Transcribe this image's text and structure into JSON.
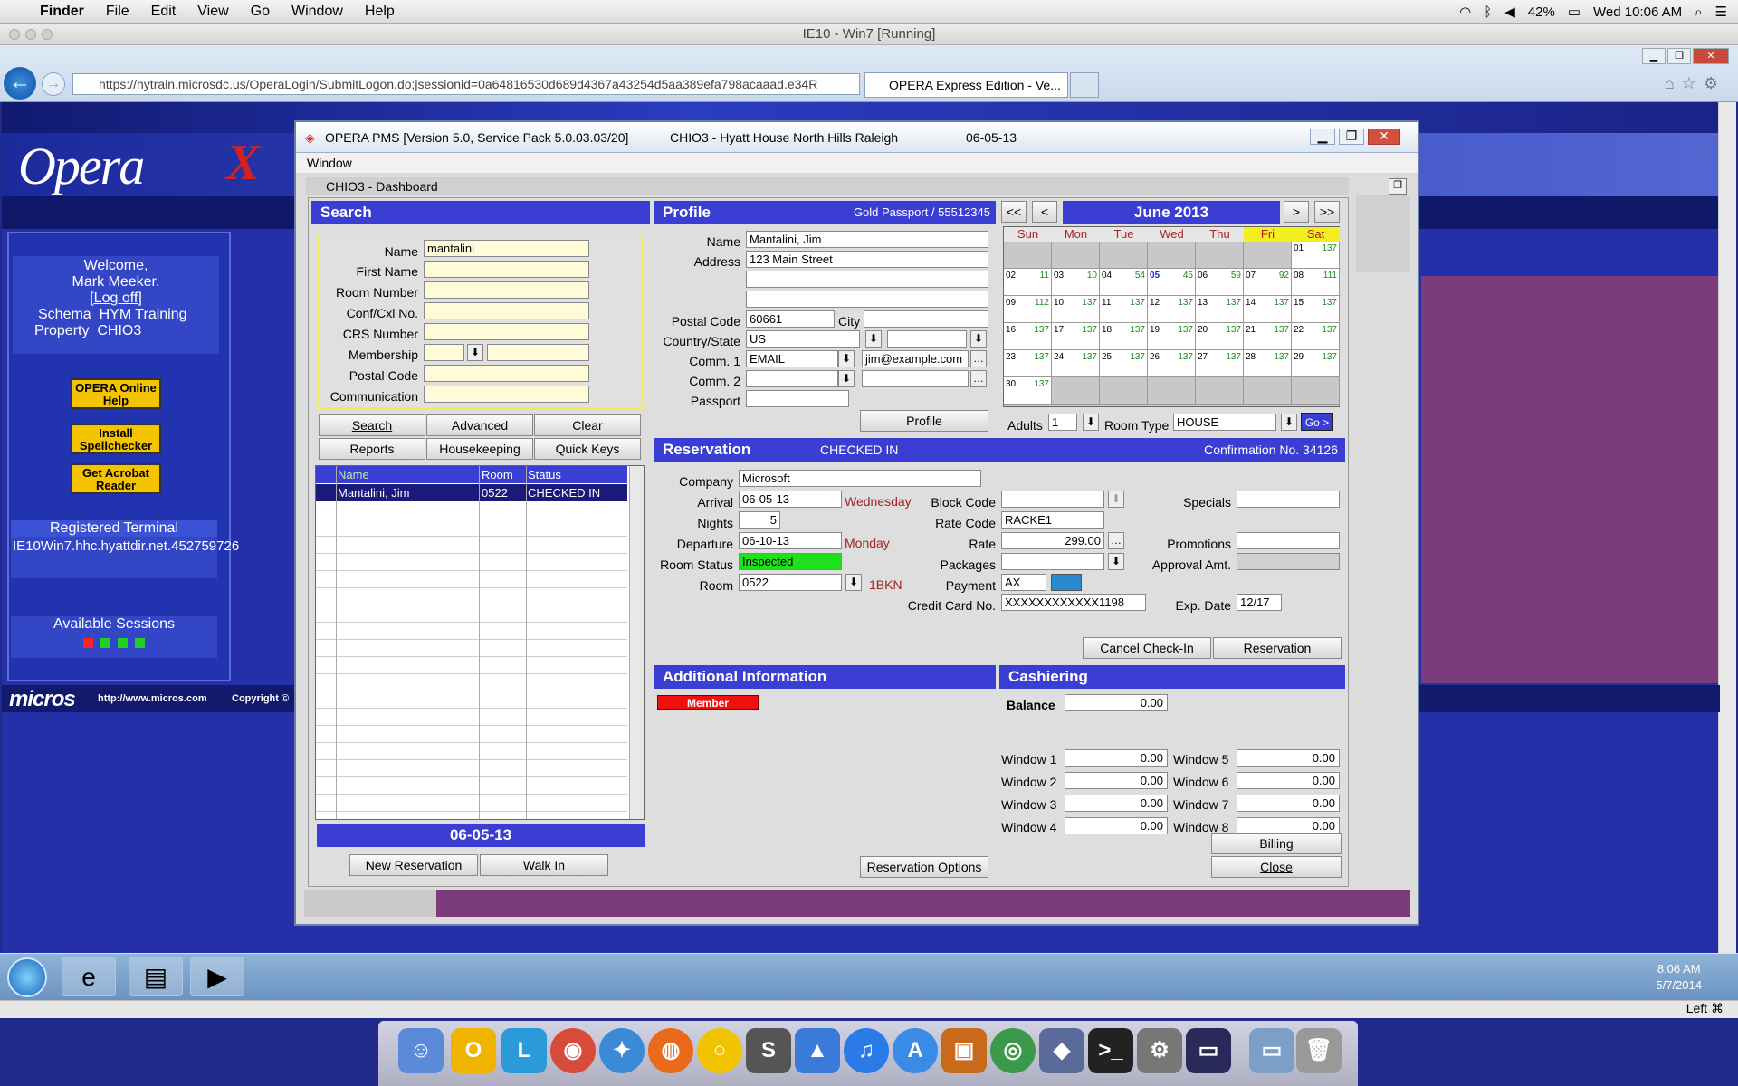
{
  "menubar": {
    "app": "Finder",
    "items": [
      "File",
      "Edit",
      "View",
      "Go",
      "Window",
      "Help"
    ],
    "battery": "42%",
    "clock": "Wed 10:06 AM"
  },
  "vm": {
    "title": "IE10 - Win7 [Running]"
  },
  "browser": {
    "url": "https://hytrain.microsdc.us/OperaLogin/SubmitLogon.do;jsessionid=0a64816530d689d4367a43254d5aa389efa798acaaad.e34R",
    "tab": "OPERA Express Edition - Ve..."
  },
  "page": {
    "welcome": "Welcome,",
    "user": "Mark Meeker.",
    "logoff": "[Log off]",
    "schema_label": "Schema",
    "schema": "HYM Training",
    "property_label": "Property",
    "property": "CHIO3",
    "help_btn": "OPERA Online Help",
    "spell_btn": "Install Spellchecker",
    "acrobat_btn": "Get Acrobat Reader",
    "terminal_label": "Registered Terminal",
    "terminal": "IE10Win7.hhc.hyattdir.net.452759726",
    "sessions_label": "Available Sessions",
    "session_colors": [
      "#ff2020",
      "#20d020",
      "#20d020",
      "#20d020"
    ],
    "micros": "micros",
    "micros_url": "http://www.micros.com",
    "copyright": "Copyright ©"
  },
  "opera": {
    "title": "OPERA PMS [Version 5.0, Service Pack 5.0.03.03/20]",
    "hotel": "CHIO3 - Hyatt House North Hills Raleigh",
    "date": "06-05-13",
    "menu": "Window",
    "dashboard": "CHIO3 - Dashboard",
    "search": {
      "title": "Search",
      "name_label": "Name",
      "name": "mantalini",
      "first_name": "First Name",
      "room_number": "Room Number",
      "conf": "Conf/Cxl No.",
      "crs": "CRS Number",
      "membership": "Membership",
      "postal": "Postal Code",
      "communication": "Communication",
      "btn_search": "Search",
      "btn_advanced": "Advanced",
      "btn_clear": "Clear",
      "btn_reports": "Reports",
      "btn_housekeeping": "Housekeeping",
      "btn_quickkeys": "Quick Keys",
      "col_name": "Name",
      "col_room": "Room",
      "col_status": "Status",
      "rows": [
        {
          "name": "Mantalini, Jim",
          "room": "0522",
          "status": "CHECKED IN"
        }
      ],
      "date": "06-05-13",
      "btn_new": "New Reservation",
      "btn_walkin": "Walk In"
    },
    "profile": {
      "title": "Profile",
      "membership": "Gold Passport / 55512345",
      "name_label": "Name",
      "name": "Mantalini, Jim",
      "address_label": "Address",
      "address": "123 Main Street",
      "postal_label": "Postal Code",
      "postal": "60661",
      "city_label": "City",
      "country_label": "Country/State",
      "country": "US",
      "comm1_label": "Comm. 1",
      "comm1_type": "EMAIL",
      "comm1": "jim@example.com",
      "comm2_label": "Comm. 2",
      "passport_label": "Passport",
      "btn_profile": "Profile"
    },
    "calendar": {
      "prev2": "<<",
      "prev": "<",
      "month": "June 2013",
      "next": ">",
      "next2": ">>",
      "days": [
        "Sun",
        "Mon",
        "Tue",
        "Wed",
        "Thu",
        "Fri",
        "Sat"
      ],
      "weeks": [
        [
          [
            "",
            ""
          ],
          [
            "",
            ""
          ],
          [
            "",
            ""
          ],
          [
            "",
            ""
          ],
          [
            "",
            ""
          ],
          [
            "",
            ""
          ],
          [
            "01",
            "137"
          ]
        ],
        [
          [
            "02",
            "11"
          ],
          [
            "03",
            "10"
          ],
          [
            "04",
            "54"
          ],
          [
            "05",
            "45"
          ],
          [
            "06",
            "59"
          ],
          [
            "07",
            "92"
          ],
          [
            "08",
            "111"
          ]
        ],
        [
          [
            "09",
            "112"
          ],
          [
            "10",
            "137"
          ],
          [
            "11",
            "137"
          ],
          [
            "12",
            "137"
          ],
          [
            "13",
            "137"
          ],
          [
            "14",
            "137"
          ],
          [
            "15",
            "137"
          ]
        ],
        [
          [
            "16",
            "137"
          ],
          [
            "17",
            "137"
          ],
          [
            "18",
            "137"
          ],
          [
            "19",
            "137"
          ],
          [
            "20",
            "137"
          ],
          [
            "21",
            "137"
          ],
          [
            "22",
            "137"
          ]
        ],
        [
          [
            "23",
            "137"
          ],
          [
            "24",
            "137"
          ],
          [
            "25",
            "137"
          ],
          [
            "26",
            "137"
          ],
          [
            "27",
            "137"
          ],
          [
            "28",
            "137"
          ],
          [
            "29",
            "137"
          ]
        ],
        [
          [
            "30",
            "137"
          ],
          [
            "",
            ""
          ],
          [
            "",
            ""
          ],
          [
            "",
            ""
          ],
          [
            "",
            ""
          ],
          [
            "",
            ""
          ],
          [
            "",
            ""
          ]
        ]
      ],
      "adults_label": "Adults",
      "adults": "1",
      "roomtype_label": "Room Type",
      "roomtype": "HOUSE",
      "go": "Go >"
    },
    "reservation": {
      "title": "Reservation",
      "status": "CHECKED IN",
      "confirmation": "Confirmation No. 34126",
      "company_label": "Company",
      "company": "Microsoft",
      "arrival_label": "Arrival",
      "arrival": "06-05-13",
      "arrival_day": "Wednesday",
      "nights_label": "Nights",
      "nights": "5",
      "departure_label": "Departure",
      "departure": "06-10-13",
      "departure_day": "Monday",
      "roomstatus_label": "Room Status",
      "roomstatus": "Inspected",
      "room_label": "Room",
      "room": "0522",
      "roomtype": "1BKN",
      "block_label": "Block Code",
      "ratecode_label": "Rate Code",
      "ratecode": "RACKE1",
      "rate_label": "Rate",
      "rate": "299.00",
      "packages_label": "Packages",
      "payment_label": "Payment",
      "payment": "AX",
      "cc_label": "Credit Card No.",
      "cc": "XXXXXXXXXXXX1198",
      "exp_label": "Exp. Date",
      "exp": "12/17",
      "specials_label": "Specials",
      "promotions_label": "Promotions",
      "approval_label": "Approval Amt.",
      "btn_cancel": "Cancel Check-In",
      "btn_reservation": "Reservation"
    },
    "additional": {
      "title": "Additional Information",
      "member": "Member",
      "btn_options": "Reservation Options"
    },
    "cashiering": {
      "title": "Cashiering",
      "balance_label": "Balance",
      "balance": "0.00",
      "windows": [
        {
          "label": "Window 1",
          "value": "0.00"
        },
        {
          "label": "Window 2",
          "value": "0.00"
        },
        {
          "label": "Window 3",
          "value": "0.00"
        },
        {
          "label": "Window 4",
          "value": "0.00"
        },
        {
          "label": "Window 5",
          "value": "0.00"
        },
        {
          "label": "Window 6",
          "value": "0.00"
        },
        {
          "label": "Window 7",
          "value": "0.00"
        },
        {
          "label": "Window 8",
          "value": "0.00"
        }
      ],
      "btn_billing": "Billing",
      "btn_close": "Close"
    }
  },
  "taskbar": {
    "time": "8:06 AM",
    "date": "5/7/2014"
  },
  "statusbar": {
    "text": "Left ⌘"
  }
}
